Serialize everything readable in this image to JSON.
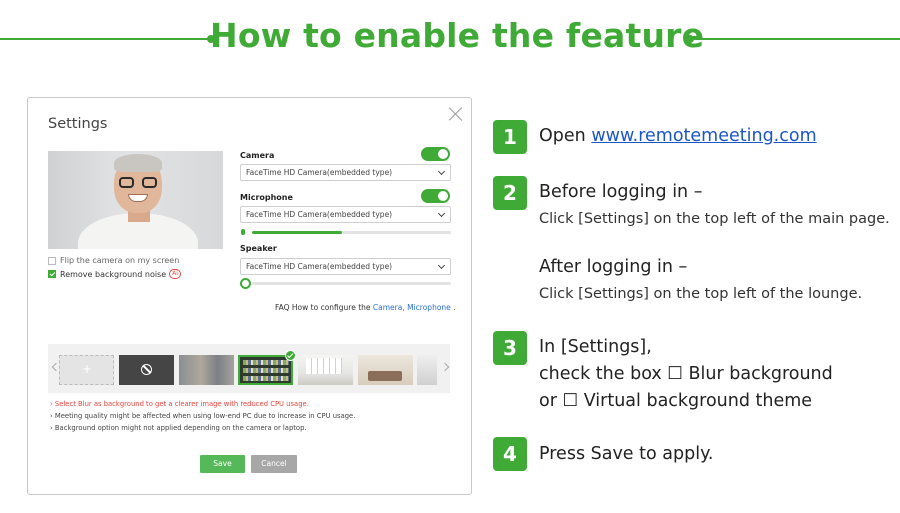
{
  "header": {
    "title": "How to enable the feature"
  },
  "settings": {
    "title": "Settings",
    "flip_camera_label": "Flip the camera on my screen",
    "remove_noise_label": "Remove background noise",
    "ai_badge": "Ai",
    "camera": {
      "label": "Camera",
      "device": "FaceTime HD Camera(embedded type)",
      "enabled": true
    },
    "microphone": {
      "label": "Microphone",
      "device": "FaceTime HD Camera(embedded type)",
      "enabled": true,
      "level": 0.45
    },
    "speaker": {
      "label": "Speaker",
      "device": "FaceTime HD Camera(embedded type)",
      "level": 0.0
    },
    "faq": {
      "prefix": "FAQ How to configure the",
      "camera_link": "Camera,",
      "microphone_link": "Microphone",
      "suffix": "."
    },
    "notes": [
      "Select Blur as background to get a clearer image with reduced CPU usage.",
      "Meeting quality might be affected when using low-end PC due to increase in CPU usage.",
      "Background option might not applied depending on the camera or laptop."
    ],
    "save_label": "Save",
    "cancel_label": "Cancel"
  },
  "steps": {
    "s1": {
      "number": "1",
      "text": "Open",
      "link": "www.remotemeeting.com"
    },
    "s2": {
      "number": "2",
      "before_title": "Before logging in –",
      "before_desc": "Click [Settings] on the top left of the main page.",
      "after_title": "After logging in –",
      "after_desc": "Click [Settings] on the top left of the lounge."
    },
    "s3": {
      "number": "3",
      "line1": "In [Settings],",
      "line2": "check the box ☐ Blur background",
      "line3": "or ☐ Virtual background theme"
    },
    "s4": {
      "number": "4",
      "text": "Press Save to apply."
    }
  },
  "colors": {
    "accent": "#3faa35",
    "link": "#1a56c8",
    "warning": "#e8433d"
  }
}
